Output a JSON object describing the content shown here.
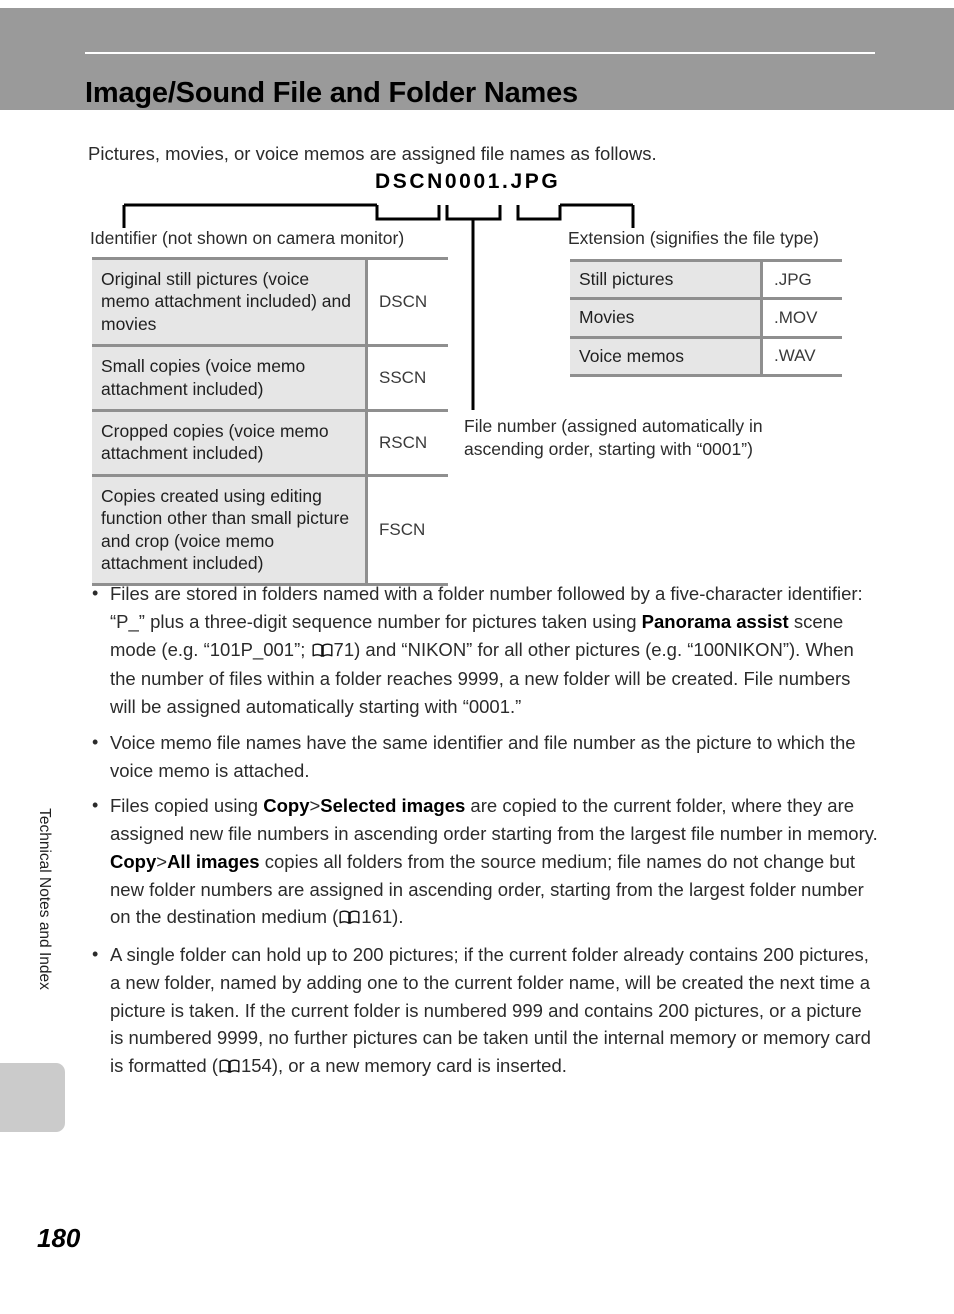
{
  "header": {
    "title": "Image/Sound File and Folder Names"
  },
  "intro": "Pictures, movies, or voice memos are assigned file names as follows.",
  "diagram": {
    "filename_sample": "DSCN0001.JPG",
    "identifier_caption": "Identifier (not shown on camera monitor)",
    "extension_caption": "Extension (signifies the file type)",
    "file_number_caption": "File number (assigned automatically in ascending order, starting with “0001”)"
  },
  "identifier_table": {
    "rows": [
      {
        "description": "Original still pictures (voice memo attachment included) and movies",
        "code": "DSCN"
      },
      {
        "description": "Small copies (voice memo attachment included)",
        "code": "SSCN"
      },
      {
        "description": "Cropped copies (voice memo attachment included)",
        "code": "RSCN"
      },
      {
        "description": "Copies created using editing function other than small picture and crop (voice memo attachment included)",
        "code": "FSCN"
      }
    ]
  },
  "extension_table": {
    "rows": [
      {
        "description": "Still pictures",
        "code": ".JPG"
      },
      {
        "description": "Movies",
        "code": ".MOV"
      },
      {
        "description": "Voice memos",
        "code": ".WAV"
      }
    ]
  },
  "bullets": {
    "marker": "•",
    "items": {
      "b1": {
        "p1": "Files are stored in folders named with a folder number followed by a five-character identifier: “P_” plus a three-digit sequence number for pictures taken using ",
        "bold1": "Panorama assist",
        "p2": " scene mode (e.g. “101P_001”; ",
        "ref1": "71",
        "p3": ") and “NIKON” for all other pictures (e.g. “100NIKON”). When the number of files within a folder reaches 9999, a new folder will be created. File numbers will be assigned automatically starting with “0001.”"
      },
      "b2": {
        "p1": "Voice memo file names have the same identifier and file number as the picture to which the voice memo is attached."
      },
      "b3": {
        "p1": "Files copied using ",
        "bold1": "Copy",
        "sep1": ">",
        "bold2": "Selected images",
        "p2": " are copied to the current folder, where they are assigned new file numbers in ascending order starting from the largest file number in memory. ",
        "bold3": "Copy",
        "sep2": ">",
        "bold4": "All images",
        "p3": " copies all folders from the source medium; file names do not change but new folder numbers are assigned in ascending order, starting from the largest folder number on the destination medium (",
        "ref1": "161",
        "p4": ")."
      },
      "b4": {
        "p1": "A single folder can hold up to 200 pictures; if the current folder already contains 200 pictures, a new folder, named by adding one to the current folder name, will be created the next time a picture is taken. If the current folder is numbered 999 and contains 200 pictures, or a picture is numbered 9999, no further pictures can be taken until the internal memory or memory card is formatted (",
        "ref1": "154",
        "p2": "), or a new memory card is inserted."
      }
    }
  },
  "side_tab": {
    "label": "Technical Notes and Index"
  },
  "footer": {
    "page_number": "180"
  },
  "colors": {
    "header_band": "#9a9a9a",
    "table_border": "#8f8f8f",
    "table_desc_bg": "#e6e6e6",
    "side_tab": "#cbcbcb"
  }
}
